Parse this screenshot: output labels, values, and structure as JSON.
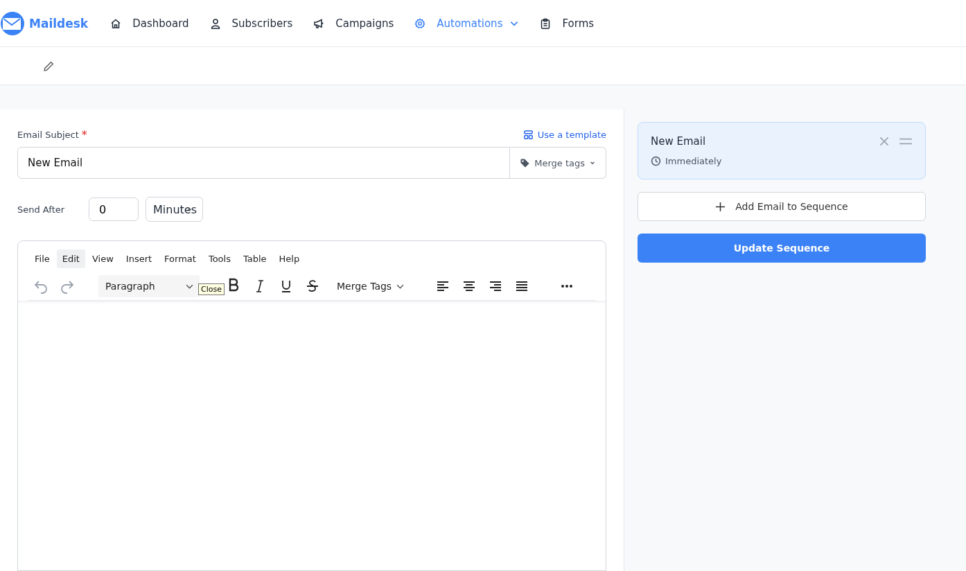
{
  "brand": "Maildesk",
  "nav": [
    {
      "label": "Dashboard",
      "selected": false,
      "dropdown": false
    },
    {
      "label": "Subscribers",
      "selected": false,
      "dropdown": false
    },
    {
      "label": "Campaigns",
      "selected": false,
      "dropdown": false
    },
    {
      "label": "Automations",
      "selected": true,
      "dropdown": true
    },
    {
      "label": "Forms",
      "selected": false,
      "dropdown": false
    }
  ],
  "subject": {
    "label": "Email Subject",
    "required_mark": "*",
    "value": "New Email",
    "template_link": "Use a template",
    "merge_button": "Merge tags"
  },
  "send_after": {
    "label": "Send After",
    "value": "0",
    "unit": "Minutes"
  },
  "editor": {
    "menu": [
      {
        "label": "File",
        "selected": false
      },
      {
        "label": "Edit",
        "selected": true
      },
      {
        "label": "View",
        "selected": false
      },
      {
        "label": "Insert",
        "selected": false
      },
      {
        "label": "Format",
        "selected": false
      },
      {
        "label": "Tools",
        "selected": false
      },
      {
        "label": "Table",
        "selected": false
      },
      {
        "label": "Help",
        "selected": false
      }
    ],
    "block_format": "Paragraph",
    "merge_tags": "Merge Tags",
    "tooltip": "Close"
  },
  "sequence": {
    "emails": [
      {
        "title": "New Email",
        "timing": "Immediately",
        "selected": true
      }
    ],
    "add_button": "Add Email to Sequence",
    "update_button": "Update Sequence"
  }
}
